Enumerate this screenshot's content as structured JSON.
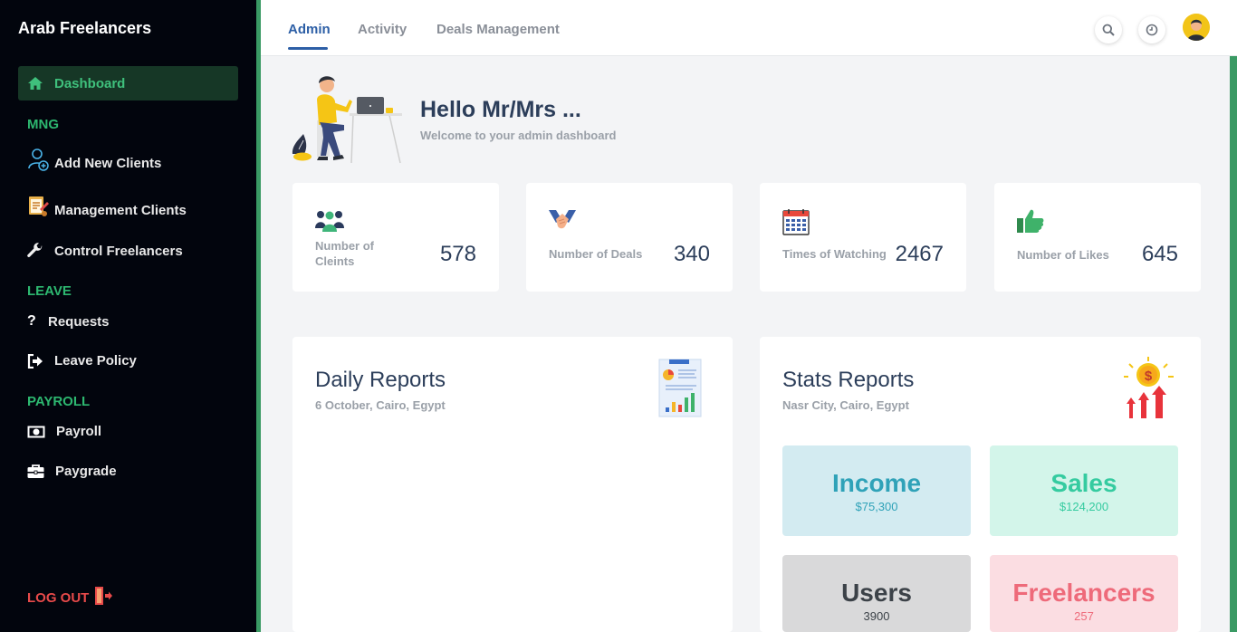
{
  "sidebar": {
    "brand": "Arab Freelancers",
    "active_item": "Dashboard",
    "sections": {
      "mng": "MNG",
      "leave": "LEAVE",
      "payroll": "PAYROLL"
    },
    "items": {
      "add_new_clients": "Add New Clients",
      "management_clients": "Management Clients",
      "control_freelancers": "Control Freelancers",
      "requests": "Requests",
      "leave_policy": "Leave Policy",
      "payroll": "Payroll",
      "paygrade": "Paygrade"
    },
    "logout": "LOG OUT"
  },
  "topbar": {
    "tabs": [
      "Admin",
      "Activity",
      "Deals Management"
    ],
    "active_tab": "Admin"
  },
  "hello": {
    "title": "Hello Mr/Mrs ...",
    "subtitle": "Welcome to your admin dashboard"
  },
  "stats": [
    {
      "label_line1": "Number of",
      "label_line2": "Cleints",
      "value": "578"
    },
    {
      "label": "Number of Deals",
      "value": "340"
    },
    {
      "label": "Times of Watching",
      "value": "2467"
    },
    {
      "label": "Number of Likes",
      "value": "645"
    }
  ],
  "daily_reports": {
    "title": "Daily Reports",
    "subtitle": "6 October, Cairo, Egypt"
  },
  "stats_reports": {
    "title": "Stats Reports",
    "subtitle": "Nasr City, Cairo, Egypt",
    "boxes": [
      {
        "title": "Income",
        "value": "$75,300"
      },
      {
        "title": "Sales",
        "value": "$124,200"
      },
      {
        "title": "Users",
        "value": "3900"
      },
      {
        "title": "Freelancers",
        "value": "257"
      }
    ]
  },
  "colors": {
    "sidebar_bg": "#02050d",
    "accent_green": "#3fc07c",
    "active_tab": "#2d5fa6",
    "income_bg": "#d3ebf1",
    "income_text": "#2fa2b8",
    "sales_bg": "#d3f5ea",
    "sales_text": "#35cba0",
    "users_bg": "#d9d9da",
    "users_text": "#3c4248",
    "freelancers_bg": "#fbdde2",
    "freelancers_text": "#ee6a7a"
  }
}
